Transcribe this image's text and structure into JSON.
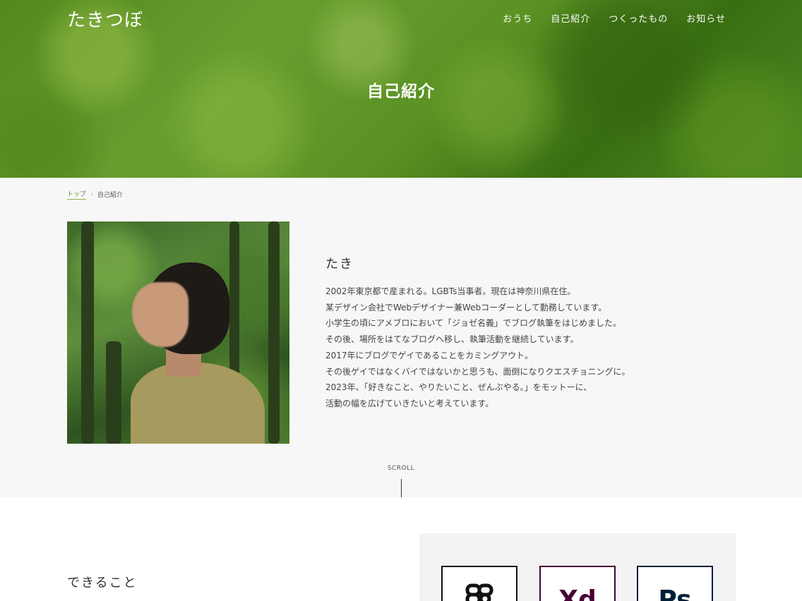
{
  "site": {
    "logo": "たきつぼ"
  },
  "nav": {
    "items": [
      "おうち",
      "自己紹介",
      "つくったもの",
      "お知らせ"
    ]
  },
  "hero": {
    "title": "自己紹介"
  },
  "breadcrumb": {
    "home": "トップ",
    "current": "自己紹介"
  },
  "profile": {
    "name": "たき",
    "bio": [
      "2002年東京都で産まれる。LGBTs当事者。現在は神奈川県在住。",
      "某デザイン会社でWebデザイナー兼Webコーダーとして勤務しています。",
      "小学生の頃にアメブロにおいて「ジョゼ名義」でブログ執筆をはじめました。",
      "その後、場所をはてなブログへ移し、執筆活動を継続しています。",
      "2017年にブログでゲイであることをカミングアウト。",
      "その後ゲイではなくバイではないかと思うも、面倒になりクエスチョニングに。",
      "2023年、「好きなこと、やりたいこと、ぜんぶやる。」をモットーに、",
      "活動の幅を広げていきたいと考えています。"
    ]
  },
  "scroll": {
    "label": "SCROLL"
  },
  "skills": {
    "title": "できること",
    "tools": [
      {
        "name": "figma-icon",
        "label": ""
      },
      {
        "name": "adobe-xd-icon",
        "label": "Xd"
      },
      {
        "name": "adobe-photoshop-icon",
        "label": "Ps"
      }
    ]
  },
  "colors": {
    "accent": "#8fb04e",
    "hero": "#5f9a24",
    "section_bg": "#f7f7f7"
  }
}
